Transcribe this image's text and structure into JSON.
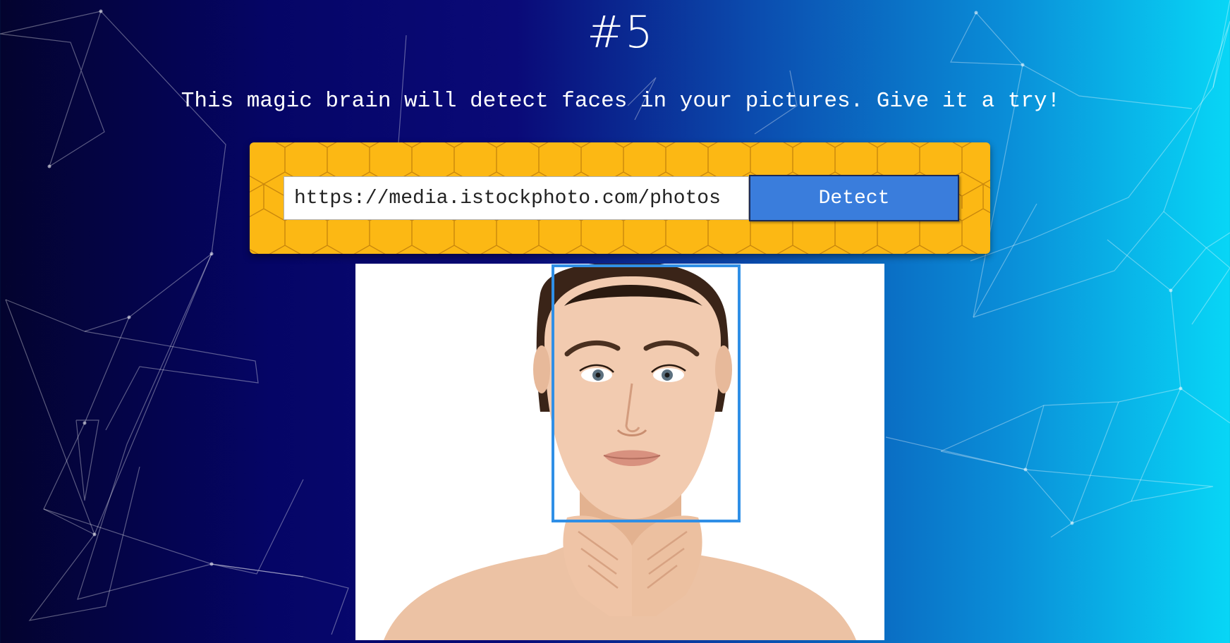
{
  "header": {
    "rank": "#5",
    "tagline": "This magic brain will detect faces in your pictures. Give it a try!"
  },
  "form": {
    "url_value": "https://media.istockphoto.com/photos",
    "button_label": "Detect"
  },
  "image": {
    "alt": "Woman portrait with face detection box"
  },
  "colors": {
    "panel": "#fcb814",
    "button": "#3a7ddc",
    "bounding_box": "#2f8fe6"
  }
}
